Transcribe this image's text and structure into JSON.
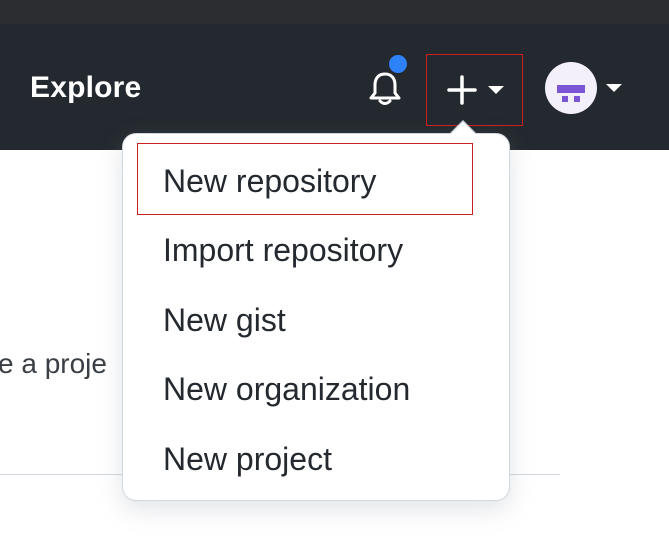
{
  "header": {
    "explore_label": "Explore"
  },
  "icons": {
    "bell": "bell-icon",
    "plus": "plus-icon",
    "caret": "caret-down-icon",
    "avatar": "avatar"
  },
  "body": {
    "partial_text": "e a proje"
  },
  "create_menu": {
    "items": [
      {
        "label": "New repository"
      },
      {
        "label": "Import repository"
      },
      {
        "label": "New gist"
      },
      {
        "label": "New organization"
      },
      {
        "label": "New project"
      }
    ]
  },
  "colors": {
    "header_bg": "#24292f",
    "notification_dot": "#2f81f7",
    "highlight_border": "#cc1f1f",
    "avatar_accent": "#7a56d6"
  }
}
